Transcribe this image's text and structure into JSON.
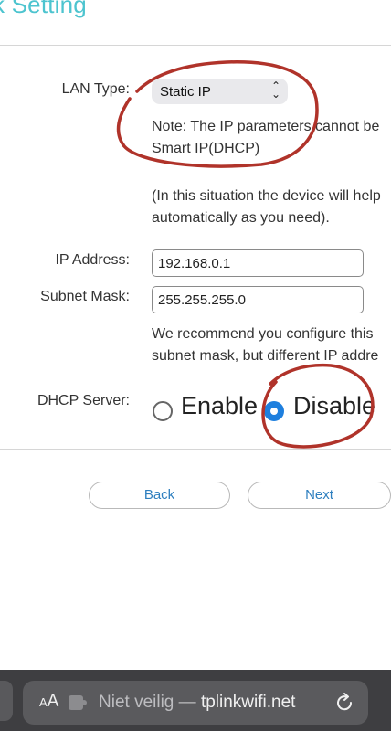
{
  "header": {
    "title": "k Setting"
  },
  "lan": {
    "label": "LAN Type:",
    "selected": "Static IP",
    "note_line1": "Note: The IP parameters cannot be",
    "note_line2": "Smart IP(DHCP)",
    "info_line1": "(In this situation the device will help",
    "info_line2": "automatically as you need)."
  },
  "ip": {
    "label": "IP Address:",
    "value": "192.168.0.1"
  },
  "subnet": {
    "label": "Subnet Mask:",
    "value": "255.255.255.0"
  },
  "recommend": {
    "line1": "We recommend you configure this",
    "line2": "subnet mask, but different IP addre"
  },
  "dhcp": {
    "label": "DHCP Server:",
    "enable_label": "Enable",
    "disable_label": "Disable",
    "selected": "Disable"
  },
  "buttons": {
    "back": "Back",
    "next": "Next"
  },
  "browser": {
    "aa_small": "A",
    "aa_large": "A",
    "security": "Niet veilig",
    "separator": " — ",
    "domain": "tplinkwifi.net"
  },
  "colors": {
    "title": "#4dc4cf",
    "radio_selected": "#1e7fde",
    "button_text": "#2e7fbf",
    "annotation": "#b0332a",
    "browser_bar": "#3e3e41"
  },
  "icons": [
    "chevron-up-down-icon",
    "reader-icon",
    "reload-icon"
  ]
}
